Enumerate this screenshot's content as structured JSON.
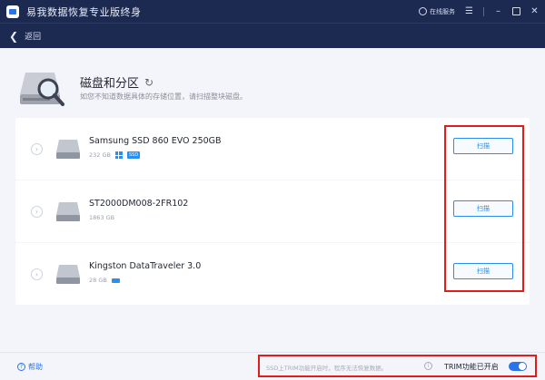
{
  "app": {
    "title": "易我数据恢复专业版终身",
    "support_label": "在线服务",
    "window_icons": [
      "menu-icon",
      "minimize-icon",
      "maximize-icon",
      "close-icon"
    ]
  },
  "nav": {
    "back_label": "返回"
  },
  "section": {
    "title": "磁盘和分区",
    "subtitle": "如您不知道数据具体的存储位置，请扫描整块磁盘。"
  },
  "drives": [
    {
      "name": "Samsung SSD 860 EVO 250GB",
      "size": "232 GB",
      "badges": [
        "windows-icon",
        "ssd-badge"
      ],
      "scan_label": "扫描"
    },
    {
      "name": "ST2000DM008-2FR102",
      "size": "1863 GB",
      "badges": [],
      "scan_label": "扫描"
    },
    {
      "name": "Kingston DataTraveler 3.0",
      "size": "28 GB",
      "badges": [
        "usb-icon"
      ],
      "scan_label": "扫描"
    }
  ],
  "footer": {
    "help_label": "帮助",
    "trim_note": "SSD上TRIM功能开启时，程序无法恢复数据。",
    "trim_label": "TRIM功能已开启",
    "trim_enabled": true
  },
  "colors": {
    "titlebar": "#1c2a52",
    "accent": "#2a8ff0",
    "highlight": "#e21b1b"
  }
}
